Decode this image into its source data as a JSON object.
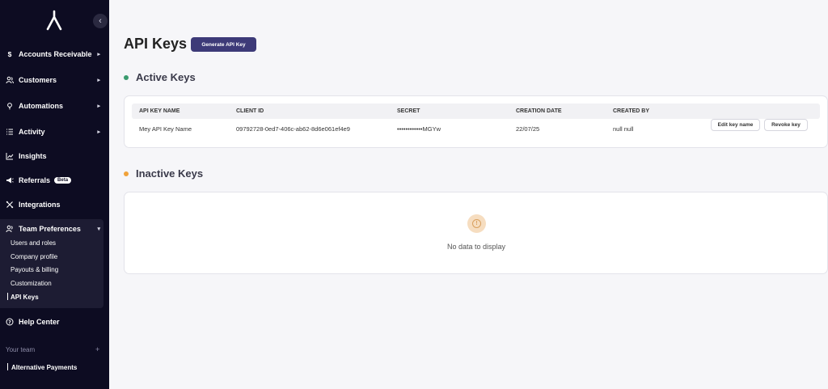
{
  "sidebar": {
    "nav": [
      {
        "label": "Accounts Receivable",
        "icon": "dollar-icon"
      },
      {
        "label": "Customers",
        "icon": "users-icon"
      },
      {
        "label": "Automations",
        "icon": "bolt-icon"
      },
      {
        "label": "Activity",
        "icon": "list-icon"
      },
      {
        "label": "Insights",
        "icon": "chart-icon"
      },
      {
        "label": "Referrals",
        "icon": "megaphone-icon",
        "badge": "Beta"
      },
      {
        "label": "Integrations",
        "icon": "puzzle-icon"
      },
      {
        "label": "Team Preferences",
        "icon": "team-icon"
      }
    ],
    "team_sub": [
      "Users and roles",
      "Company profile",
      "Payouts & billing",
      "Customization",
      "API Keys"
    ],
    "help": "Help Center",
    "your_team": "Your team",
    "team_name": "Alternative Payments"
  },
  "main": {
    "title": "API Keys",
    "generate_button": "Generate API Key",
    "active_title": "Active Keys",
    "inactive_title": "Inactive Keys",
    "columns": [
      "API KEY NAME",
      "CLIENT ID",
      "SECRET",
      "CREATION DATE",
      "CREATED BY"
    ],
    "rows": [
      {
        "name": "Mey API Key Name",
        "client_id": "09792728-0ed7-406c-ab62-8d6e061ef4e9",
        "secret": "••••••••••••MGYw",
        "created": "22/07/25",
        "created_by": "null null",
        "edit_label": "Edit key name",
        "revoke_label": "Revoke key"
      }
    ],
    "empty_text": "No data to display"
  },
  "colors": {
    "sidebar_bg": "#0d0c22",
    "accent": "#3d3a78",
    "active_dot": "#3a9a6e",
    "inactive_dot": "#f0a23b"
  }
}
